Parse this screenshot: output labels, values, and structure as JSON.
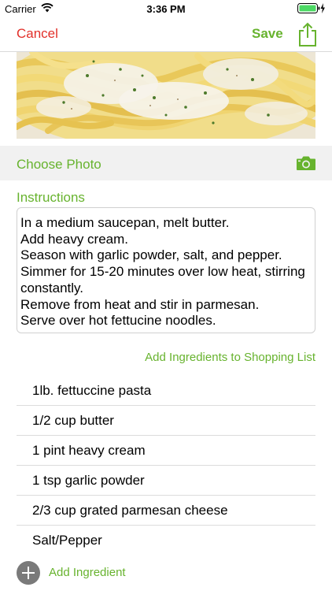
{
  "status_bar": {
    "carrier": "Carrier",
    "time": "3:36 PM",
    "icons": [
      "wifi-icon",
      "battery-icon",
      "charging-icon"
    ]
  },
  "nav": {
    "cancel_label": "Cancel",
    "save_label": "Save",
    "share_icon": "share-icon"
  },
  "photo": {
    "subject": "fettuccine-alfredo"
  },
  "choose_photo": {
    "label": "Choose Photo",
    "icon": "camera-icon"
  },
  "instructions": {
    "title": "Instructions",
    "text": "In a medium saucepan, melt butter.\nAdd heavy cream.\nSeason with garlic powder, salt, and pepper.\nSimmer for 15-20 minutes over low heat, stirring constantly.\nRemove from heat and stir in parmesan.\nServe over hot fettucine noodles."
  },
  "shopping_link": "Add Ingredients to Shopping List",
  "ingredients": [
    "1lb. fettuccine pasta",
    "1/2 cup butter",
    "1 pint heavy cream",
    "1 tsp garlic powder",
    "2/3 cup grated parmesan cheese",
    "Salt/Pepper"
  ],
  "add_ingredient": {
    "label": "Add Ingredient",
    "icon": "plus-circle-icon"
  },
  "colors": {
    "accent_green": "#67b32e",
    "cancel_red": "#e2302a",
    "separator": "#dcdcdc",
    "row_bg": "#f1f1f1"
  }
}
